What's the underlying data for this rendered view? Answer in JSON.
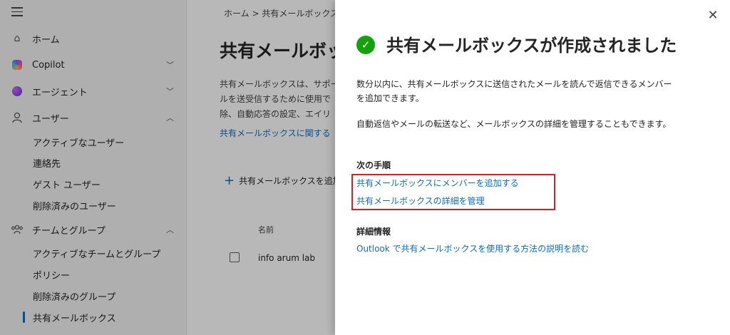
{
  "nav": {
    "home": "ホーム",
    "copilot": "Copilot",
    "agent": "エージェント",
    "users": "ユーザー",
    "users_sub": [
      "アクティブなユーザー",
      "連絡先",
      "ゲスト ユーザー",
      "削除済みのユーザー"
    ],
    "teams": "チームとグループ",
    "teams_sub": [
      "アクティブなチームとグループ",
      "ポリシー",
      "削除済みのグループ",
      "共有メールボックス"
    ],
    "icons": {
      "menu": "hamburger-icon",
      "home": "home-icon",
      "copilot": "copilot-icon",
      "agent": "agent-icon",
      "users": "person-icon",
      "teams": "people-team-icon"
    }
  },
  "main": {
    "breadcrumb": "ホーム  >  共有メールボックス",
    "title": "共有メールボックス",
    "desc_lines": [
      "共有メールボックスは、サポート",
      "ルを送受信するために使用で",
      "除、自動応答の設定、エイリ"
    ],
    "learn_link": "共有メールボックスに関する",
    "add_button": "共有メールボックスを追加",
    "col_name": "名前",
    "row_name": "info arum lab"
  },
  "panel": {
    "title": "共有メールボックスが作成されました",
    "para1_lines": [
      "数分以内に、共有メールボックスに送信されたメールを読んで返信できるメンバー",
      "を追加できます。"
    ],
    "para2": "自動返信やメールの転送など、メールボックスの詳細を管理することもできます。",
    "next_steps_heading": "次の手順",
    "link_add_members": "共有メールボックスにメンバーを追加する",
    "link_manage_details": "共有メールボックスの詳細を管理",
    "more_info_heading": "詳細情報",
    "link_outlook": "Outlook で共有メールボックスを使用する方法の説明を読む",
    "close_icon": "close-icon",
    "success_icon": "checkmark-circle-icon"
  },
  "colors": {
    "link": "#0f6cbd",
    "success": "#13a10e",
    "highlight": "#d0202a"
  }
}
